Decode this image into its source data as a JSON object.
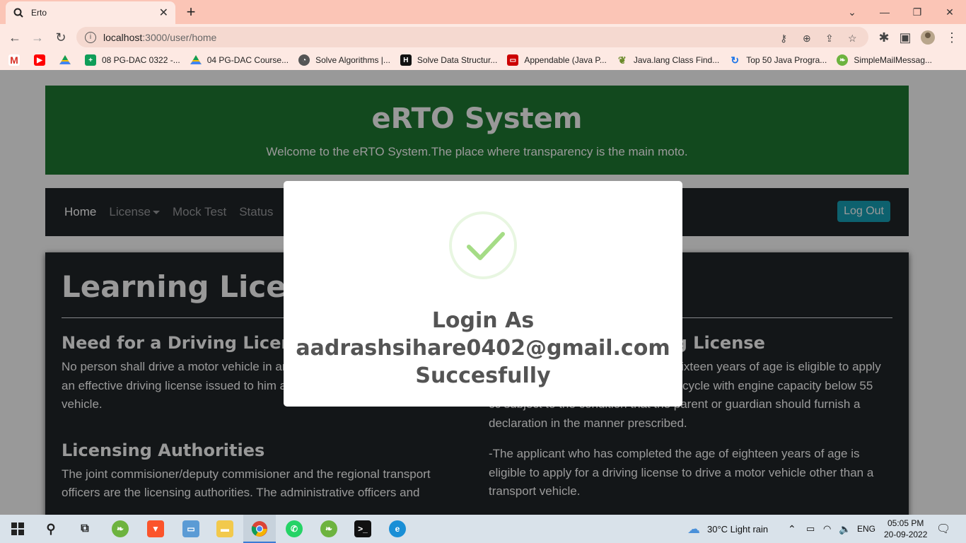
{
  "browser": {
    "tab_title": "Erto",
    "url_host": "localhost",
    "url_rest": ":3000/user/home",
    "bookmarks": [
      "08 PG-DAC 0322 -...",
      "04 PG-DAC Course...",
      "Solve Algorithms |...",
      "Solve Data Structur...",
      "Appendable (Java P...",
      "Java.lang Class Find...",
      "Top 50 Java Progra...",
      "SimpleMailMessag..."
    ]
  },
  "hero": {
    "title": "eRTO System",
    "subtitle": "Welcome to the eRTO System.The place where transparency is the main moto."
  },
  "navbar": {
    "home": "Home",
    "license": "License",
    "mock_test": "Mock Test",
    "status": "Status",
    "logout": "Log Out"
  },
  "content": {
    "title": "Learning License",
    "left": {
      "h1": "Need for a Driving License",
      "p1": "No person shall drive a motor vehicle in any public place unless he holds an effective driving license issued to him authosrising him to drive the vehicle.",
      "h2": "Licensing Authorities",
      "p2": "The joint commisioner/deputy commisioner and the regional transport officers are the licensing authorities. The administrative officers and"
    },
    "right": {
      "h1": "Eligibility for Driving License",
      "p1": "-The applicant who has completed sixteen years of age is eligible to apply for a driving license to drive a motor cycle with engine capacity below 55 cc subject to the condition that the parent or guardian should furnish a declaration in the manner prescribed.",
      "p2": "-The applicant who has completed the age of eighteen years of age is eligible to apply for a driving license to drive a motor vehicle other than a transport vehicle."
    }
  },
  "modal": {
    "line1": "Login As",
    "line2": "aadrashsihare0402@gmail.com",
    "line3": "Succesfully"
  },
  "taskbar": {
    "weather": "30°C  Light rain",
    "lang": "ENG",
    "time": "05:05 PM",
    "date": "20-09-2022"
  },
  "colors": {
    "hero_bg": "#1f7a32",
    "nav_bg": "#212529",
    "logout_bg": "#17a2b8",
    "tab_strip": "#fbc5b6",
    "check_green": "#a5dc86"
  }
}
